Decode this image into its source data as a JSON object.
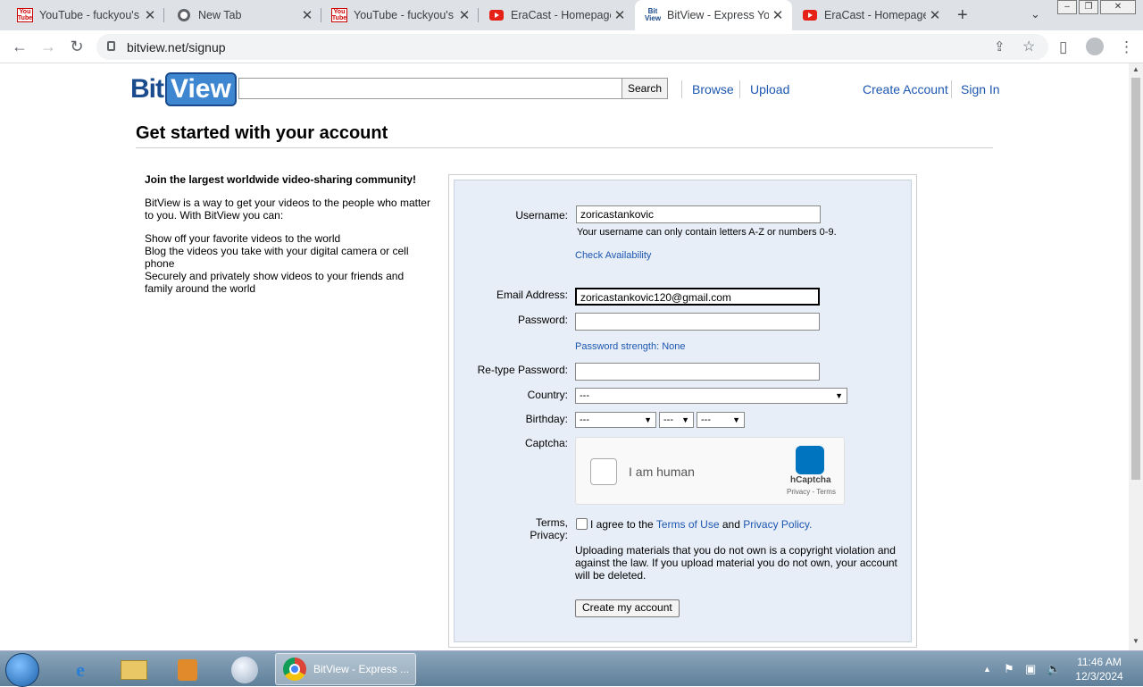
{
  "browser": {
    "tabs": [
      {
        "title": "YouTube - fuckyou's",
        "icon": "youtube-icon"
      },
      {
        "title": "New Tab",
        "icon": "chrome-icon"
      },
      {
        "title": "YouTube - fuckyou's",
        "icon": "youtube-icon"
      },
      {
        "title": "EraCast - Homepage",
        "icon": "youtube-red-icon"
      },
      {
        "title": "BitView - Express You",
        "icon": "bitview-icon"
      },
      {
        "title": "EraCast - Homepage",
        "icon": "youtube-red-icon"
      }
    ],
    "url": "bitview.net/signup"
  },
  "site": {
    "logo_bit": "Bit",
    "logo_view": "View",
    "search_button": "Search",
    "nav": {
      "browse": "Browse",
      "upload": "Upload",
      "create_account": "Create Account",
      "sign_in": "Sign In"
    }
  },
  "page": {
    "title": "Get started with your account",
    "intro_heading": "Join the largest worldwide video-sharing community!",
    "intro_text": "BitView is a way to get your videos to the people who matter to you. With BitView you can:",
    "intro_list": [
      "Show off your favorite videos to the world",
      "Blog the videos you take with your digital camera or cell phone",
      "Securely and privately show videos to your friends and family around the world"
    ]
  },
  "form": {
    "username_label": "Username:",
    "username_value": "zoricastankovic",
    "username_hint": "Your username can only contain letters A-Z or numbers 0-9.",
    "check_availability": "Check Availability",
    "email_label": "Email Address:",
    "email_value": "zoricastankovic120@gmail.com",
    "password_label": "Password:",
    "password_strength": "Password strength: None",
    "retype_label": "Re-type Password:",
    "country_label": "Country:",
    "country_value": "---",
    "birthday_label": "Birthday:",
    "birthday_month": "---",
    "birthday_day": "---",
    "birthday_year": "---",
    "captcha_label": "Captcha:",
    "captcha_text": "I am human",
    "captcha_brand": "hCaptcha",
    "captcha_links": "Privacy - Terms",
    "terms_label_1": "Terms,",
    "terms_label_2": "Privacy:",
    "agree_prefix": "I agree to the",
    "terms_link": "Terms of Use",
    "and_text": "and",
    "privacy_link": "Privacy Policy.",
    "copyright_notice": "Uploading materials that you do not own is a copyright violation and against the law. If you upload material you do not own, your account will be deleted.",
    "submit": "Create my account"
  },
  "taskbar": {
    "active_app": "BitView - Express ...",
    "time": "11:46 AM",
    "date": "12/3/2024"
  }
}
